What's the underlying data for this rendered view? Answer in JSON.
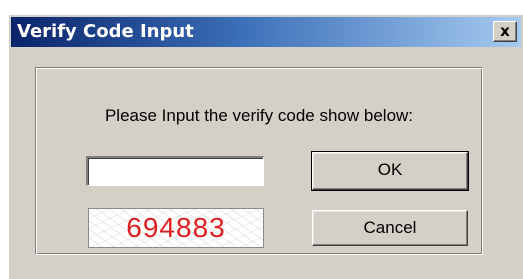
{
  "window": {
    "title": "Verify Code Input",
    "close_symbol": "x"
  },
  "dialog": {
    "prompt": "Please Input the verify code show below:",
    "code_input_value": "",
    "captcha_code": "694883",
    "ok_label": "OK",
    "cancel_label": "Cancel"
  },
  "icons": {
    "close": "close-icon"
  },
  "colors": {
    "titlebar_start": "#0a246a",
    "titlebar_end": "#a6caf0",
    "dialog_background": "#d4d0c8",
    "captcha_text": "#e02020"
  }
}
